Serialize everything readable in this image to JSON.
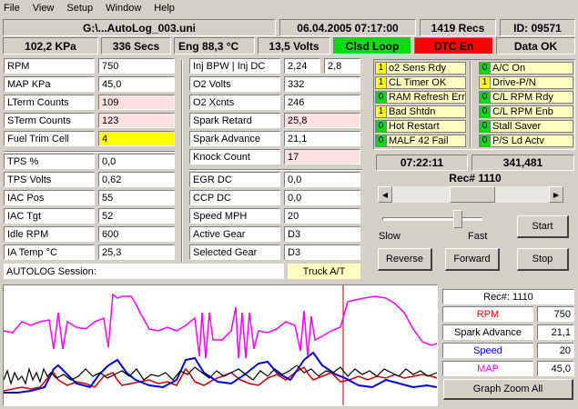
{
  "menu": [
    "File",
    "View",
    "Setup",
    "Window",
    "Help"
  ],
  "status1": {
    "file": "G:\\...AutoLog_003.uni",
    "datetime": "06.04.2005  07:17:00",
    "recs": "1419 Recs",
    "id": "ID:  09571"
  },
  "status2": {
    "kpa": "102,2 KPa",
    "secs": "336 Secs",
    "eng_label": "Eng",
    "eng_temp": "88,3 °C",
    "volts": "13,5 Volts",
    "loop": "Clsd Loop",
    "dtc": "DTC En",
    "data": "Data OK"
  },
  "colors": {
    "loop_bg": "#00e000",
    "dtc_bg": "#ff0000",
    "rpm": "#ff0000",
    "spark": "#000000",
    "speed": "#0000ff",
    "map": "#ff00ff"
  },
  "col1": [
    {
      "label": "RPM",
      "value": "750",
      "style": ""
    },
    {
      "label": "MAP KPa",
      "value": "45,0",
      "style": ""
    },
    {
      "label": "LTerm Counts",
      "value": "109",
      "style": "pink"
    },
    {
      "label": "STerm Counts",
      "value": "123",
      "style": "pink"
    },
    {
      "label": "Fuel Trim Cell",
      "value": "4",
      "style": "yellow"
    },
    {
      "label": "TPS %",
      "value": "0,0",
      "style": ""
    },
    {
      "label": "TPS Volts",
      "value": "0,62",
      "style": ""
    },
    {
      "label": "IAC Pos",
      "value": "55",
      "style": ""
    },
    {
      "label": "IAC Tgt",
      "value": "52",
      "style": ""
    },
    {
      "label": "Idle RPM",
      "value": "600",
      "style": ""
    },
    {
      "label": "IA Temp °C",
      "value": "25,3",
      "style": ""
    }
  ],
  "col2": [
    {
      "label": "Inj BPW  |  Inj DC",
      "value": "2,24",
      "value2": "2,8",
      "style": ""
    },
    {
      "label": "O2 Volts",
      "value": "332",
      "style": ""
    },
    {
      "label": "O2 Xcnts",
      "value": "246",
      "style": ""
    },
    {
      "label": "Spark Retard",
      "value": "25,8",
      "style": "pink"
    },
    {
      "label": "Spark Advance",
      "value": "21,1",
      "style": ""
    },
    {
      "label": "Knock Count",
      "value": "17",
      "style": "pink"
    },
    {
      "label": "EGR DC",
      "value": "0,0",
      "style": ""
    },
    {
      "label": "CCP DC",
      "value": "0,0",
      "style": ""
    },
    {
      "label": "Speed MPH",
      "value": "20",
      "style": ""
    },
    {
      "label": "Active Gear",
      "value": "D3",
      "style": ""
    },
    {
      "label": "Selected Gear",
      "value": "D3",
      "style": ""
    }
  ],
  "session": {
    "label": "AUTOLOG Session:",
    "truck": "Truck A/T"
  },
  "flags_left": [
    {
      "n": "1",
      "text": "o2 Sens Rdy"
    },
    {
      "n": "1",
      "text": "CL Timer OK"
    },
    {
      "n": "0",
      "text": "RAM Refresh Err"
    },
    {
      "n": "1",
      "text": "Bad Shtdn"
    },
    {
      "n": "0",
      "text": "Hot Restart"
    },
    {
      "n": "0",
      "text": "MALF 42 Fail"
    }
  ],
  "flags_right": [
    {
      "n": "0",
      "text": "A/C On"
    },
    {
      "n": "1",
      "text": "Drive-P/N"
    },
    {
      "n": "0",
      "text": "C/L RPM Rdy"
    },
    {
      "n": "0",
      "text": "C/L RPM Enb"
    },
    {
      "n": "0",
      "text": "Stall Saver"
    },
    {
      "n": "0",
      "text": "P/S Ld Actv"
    }
  ],
  "player": {
    "time": "07:22:11",
    "count": "341,481",
    "rec": "Rec# 1110",
    "position": 0.52,
    "speed_level": 0.78,
    "slow": "Slow",
    "fast": "Fast",
    "start": "Start",
    "reverse": "Reverse",
    "forward": "Forward",
    "stop": "Stop"
  },
  "graph": {
    "rec_label": "Rec#:  1110",
    "legend": [
      {
        "name": "RPM",
        "value": "750",
        "color": "#ff0000"
      },
      {
        "name": "Spark Advance",
        "value": "21,1",
        "color": "#000000"
      },
      {
        "name": "Speed",
        "value": "20",
        "color": "#0000ff"
      },
      {
        "name": "MAP",
        "value": "45,0",
        "color": "#ff00ff"
      }
    ],
    "zoom": "Graph Zoom All"
  }
}
